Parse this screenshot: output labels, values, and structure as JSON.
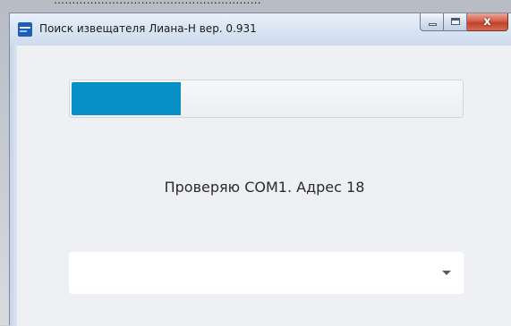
{
  "background": {
    "text": "…………………………………………………"
  },
  "window": {
    "title": "Поиск извещателя Лиана-Н вер. 0.931",
    "icon": "app-logo-icon",
    "buttons": {
      "minimize": "minimize-icon",
      "maximize": "maximize-icon",
      "close_label": "x"
    }
  },
  "progress": {
    "fraction": 0.28,
    "fill_color": "#0690c6"
  },
  "status": {
    "text": "Проверяю COM1. Адрес 18"
  },
  "device_select": {
    "value": "",
    "icon": "chevron-down-icon"
  },
  "colors": {
    "accent": "#0690c6",
    "close_button": "#c2412a",
    "client_background": "#eef0f3"
  }
}
